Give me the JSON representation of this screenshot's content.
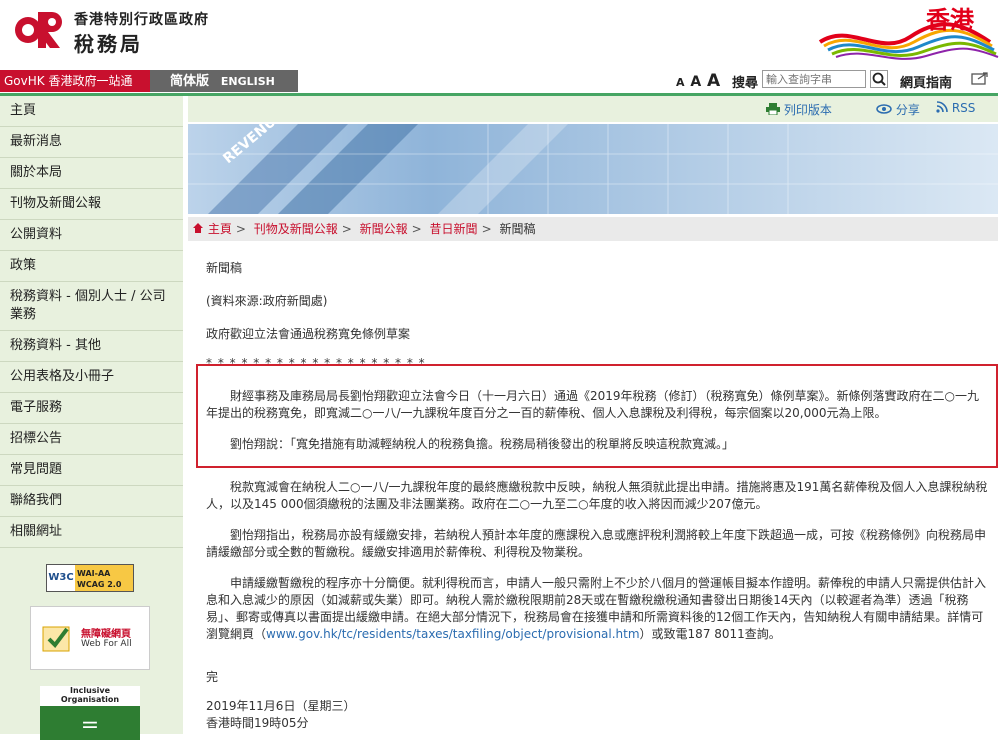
{
  "header": {
    "dept_line1": "香港特別行政區政府",
    "dept_name": "稅務局",
    "brand": "香港"
  },
  "topbar": {
    "govhk": "GovHK 香港政府一站通",
    "lang_simplified": "简体版",
    "lang_english": "ENGLISH",
    "font_sizes": [
      "A",
      "A",
      "A"
    ],
    "search_label": "搜尋",
    "search_placeholder": "輸入查詢字串",
    "sitemap": "網頁指南"
  },
  "sidebar": {
    "items": [
      {
        "label": "主頁"
      },
      {
        "label": "最新消息"
      },
      {
        "label": "關於本局"
      },
      {
        "label": "刊物及新聞公報"
      },
      {
        "label": "公開資料"
      },
      {
        "label": "政策"
      },
      {
        "label": "稅務資料 - 個別人士 / 公司業務"
      },
      {
        "label": "稅務資料 - 其他"
      },
      {
        "label": "公用表格及小冊子"
      },
      {
        "label": "電子服務"
      },
      {
        "label": "招標公告"
      },
      {
        "label": "常見問題"
      },
      {
        "label": "聯絡我們"
      },
      {
        "label": "相關網址"
      }
    ],
    "badges": {
      "wcag": "WAI-AA WCAG 2.0",
      "w3c": "W3C",
      "web_for_all_cn": "無障礙網頁",
      "web_for_all_en": "Web For All",
      "inclusive": "Inclusive Organisation"
    }
  },
  "toolbar": {
    "print": "列印版本",
    "share": "分享",
    "rss": "RSS"
  },
  "banner": {
    "revenue": "REVENUE"
  },
  "breadcrumb": [
    "主頁",
    "刊物及新聞公報",
    "新聞公報",
    "昔日新聞",
    "新聞稿"
  ],
  "article": {
    "heading": "新聞稿",
    "source": "(資料來源:政府新聞處)",
    "title": "政府歡迎立法會通過稅務寬免條例草案",
    "stars": "* * * * * * * * * * * * * * * * * * *",
    "p1": "財經事務及庫務局局長劉怡翔歡迎立法會今日（十一月六日）通過《2019年稅務（修訂）（稅務寬免）條例草案》。新條例落實政府在二○一九年提出的稅務寬免，即寬減二○一八/一九課稅年度百分之一百的薪俸稅、個人入息課稅及利得稅，每宗個案以20,000元為上限。",
    "p2": "劉怡翔說：「寬免措施有助減輕納稅人的稅務負擔。稅務局稍後發出的稅單將反映這稅款寬減。」",
    "p3": "稅款寬減會在納稅人二○一八/一九課稅年度的最終應繳稅款中反映，納稅人無須就此提出申請。措施將惠及191萬名薪俸稅及個人入息課稅納稅人，以及145 000個須繳稅的法團及非法團業務。政府在二○一九至二○年度的收入將因而減少207億元。",
    "p4": "劉怡翔指出，稅務局亦設有緩繳安排，若納稅人預計本年度的應課稅入息或應評稅利潤將較上年度下跌超過一成，可按《稅務條例》向稅務局申請緩繳部分或全數的暫繳稅。緩繳安排適用於薪俸稅、利得稅及物業稅。",
    "p5_a": "申請緩繳暫繳稅的程序亦十分簡便。就利得稅而言，申請人一般只需附上不少於八個月的營運帳目擬本作證明。薪俸稅的申請人只需提供估計入息和入息減少的原因（如減薪或失業）即可。納稅人需於繳稅限期前28天或在暫繳稅繳稅通知書發出日期後14天內（以較遲者為準）透過「稅務易」、郵寄或傳真以書面提出緩繳申請。在絕大部分情況下，稅務局會在接獲申請和所需資料後的12個工作天內，告知納稅人有關申請結果。詳情可瀏覽網頁（",
    "p5_link": "www.gov.hk/tc/residents/taxes/taxfiling/object/provisional.htm",
    "p5_b": "）或致電187 8011查詢。",
    "end": "完",
    "date": "2019年11月6日（星期三）",
    "time": "香港時間19時05分"
  },
  "colors": {
    "brand_red": "#c8102e",
    "green": "#46a563",
    "sidebar_bg": "#e8f1de",
    "highlight": "#d0212e",
    "link": "#2b6cb0"
  }
}
